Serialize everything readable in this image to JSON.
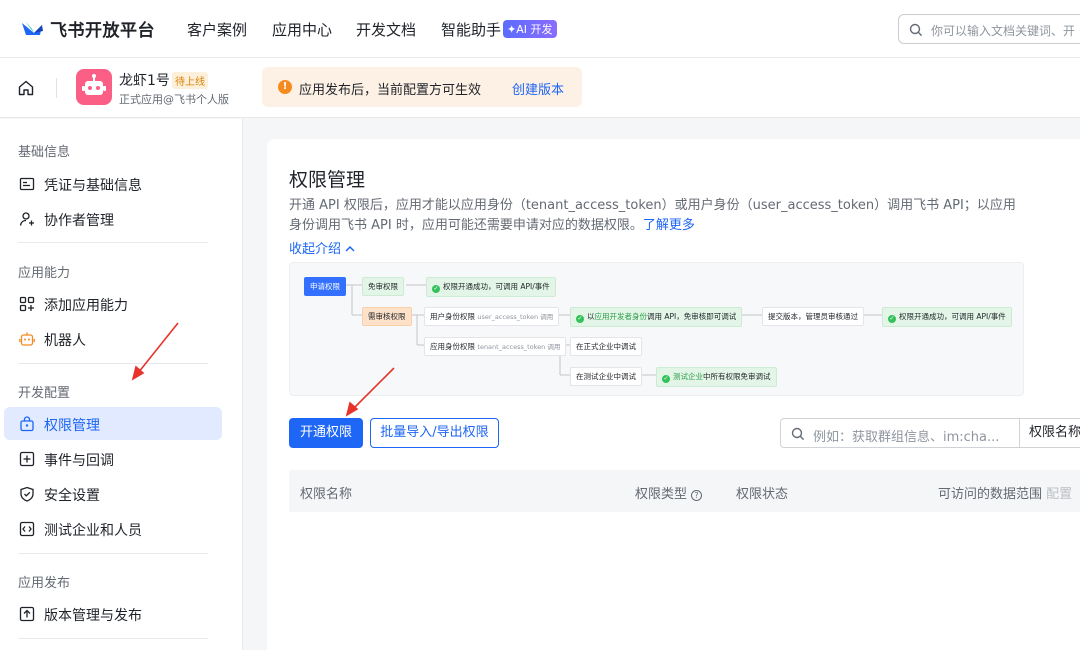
{
  "topnav": {
    "brand": "飞书开放平台",
    "links": [
      "客户案例",
      "应用中心",
      "开发文档",
      "智能助手"
    ],
    "ai_badge": "✦AI 开发",
    "search_placeholder": "你可以输入文档关键词、开"
  },
  "appbar": {
    "app_name": "龙虾1号",
    "status_badge": "待上线",
    "app_subtitle": "正式应用@飞书个人版",
    "notice_text": "应用发布后，当前配置方可生效",
    "notice_link": "创建版本"
  },
  "sidebar": {
    "sections": [
      {
        "title": "基础信息",
        "items": [
          {
            "label": "凭证与基础信息",
            "icon": "id-card-icon"
          },
          {
            "label": "协作者管理",
            "icon": "user-add-icon"
          }
        ]
      },
      {
        "title": "应用能力",
        "items": [
          {
            "label": "添加应用能力",
            "icon": "grid-add-icon"
          },
          {
            "label": "机器人",
            "icon": "robot-icon"
          }
        ]
      },
      {
        "title": "开发配置",
        "items": [
          {
            "label": "权限管理",
            "icon": "lock-icon",
            "active": true
          },
          {
            "label": "事件与回调",
            "icon": "event-icon"
          },
          {
            "label": "安全设置",
            "icon": "shield-icon"
          },
          {
            "label": "测试企业和人员",
            "icon": "test-icon"
          }
        ]
      },
      {
        "title": "应用发布",
        "items": [
          {
            "label": "版本管理与发布",
            "icon": "upload-icon"
          }
        ]
      }
    ]
  },
  "main": {
    "title": "权限管理",
    "desc_text": "开通 API 权限后，应用才能以应用身份（tenant_access_token）或用户身份（user_access_token）调用飞书 API；以应用身份调用飞书 API 时，应用可能还需要申请对应的数据权限。",
    "learn_more": "了解更多",
    "collapse_label": "收起介绍",
    "flow": {
      "apply": "申请权限",
      "free_review": "免审权限",
      "success_top": "权限开通成功，可调用 API/事件",
      "need_review": "需审核权限",
      "user_identity": "用户身份权限",
      "user_token": "user_access_token 调用",
      "dev_call_prefix": "以",
      "dev_call_highlight": "应用开发者身份",
      "dev_call_suffix": "调用 API，免审核即可调试",
      "submit_version": "提交版本，管理员审核通过",
      "success_right": "权限开通成功，可调用 API/事件",
      "app_identity": "应用身份权限",
      "tenant_token": "tenant_access_token 调用",
      "prod_debug": "在正式企业中调试",
      "test_debug": "在测试企业中调试",
      "test_free_highlight": "测试企业",
      "test_free_suffix": "中所有权限免审调试"
    },
    "btn_open": "开通权限",
    "btn_batch": "批量导入/导出权限",
    "search_placeholder": "例如：获取群组信息、im:cha...",
    "search_select": "权限名称",
    "columns": {
      "name": "权限名称",
      "type": "权限类型",
      "status": "权限状态",
      "range": "可访问的数据范围",
      "range_config": "配置"
    }
  },
  "colors": {
    "accent": "#1e66f5",
    "annotation_arrow": "#e8332a"
  }
}
